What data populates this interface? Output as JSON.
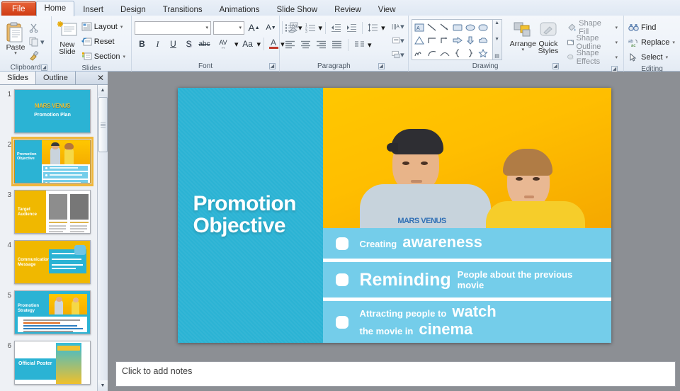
{
  "ribbon": {
    "tabs": [
      {
        "label": "File",
        "type": "file"
      },
      {
        "label": "Home",
        "type": "active"
      },
      {
        "label": "Insert",
        "type": "normal"
      },
      {
        "label": "Design",
        "type": "normal"
      },
      {
        "label": "Transitions",
        "type": "normal"
      },
      {
        "label": "Animations",
        "type": "normal"
      },
      {
        "label": "Slide Show",
        "type": "normal"
      },
      {
        "label": "Review",
        "type": "normal"
      },
      {
        "label": "View",
        "type": "normal"
      }
    ],
    "groups": {
      "clipboard": {
        "label": "Clipboard",
        "paste_label": "Paste",
        "cut_tooltip": "Cut",
        "copy_tooltip": "Copy",
        "format_painter_tooltip": "Format Painter"
      },
      "slides": {
        "label": "Slides",
        "new_slide_label": "New\nSlide",
        "new_slide_line1": "New",
        "new_slide_line2": "Slide",
        "layout_label": "Layout",
        "reset_label": "Reset",
        "section_label": "Section"
      },
      "font": {
        "label": "Font",
        "font_name_value": "",
        "font_name_placeholder": "",
        "font_size_value": "",
        "grow_font": "A",
        "shrink_font": "A",
        "clear_formatting": "clear-formatting",
        "bold": "B",
        "italic": "I",
        "underline": "U",
        "shadow": "S",
        "strikethrough": "abc",
        "char_spacing": "AV",
        "change_case": "Aa",
        "font_color": "A"
      },
      "paragraph": {
        "label": "Paragraph"
      },
      "drawing": {
        "label": "Drawing",
        "arrange_label": "Arrange",
        "quick_styles_line1": "Quick",
        "quick_styles_line2": "Styles",
        "shape_fill_label": "Shape Fill",
        "shape_outline_label": "Shape Outline",
        "shape_effects_label": "Shape Effects"
      },
      "editing": {
        "label": "Editing",
        "find_label": "Find",
        "replace_label": "Replace",
        "select_label": "Select"
      }
    }
  },
  "left_panel": {
    "tab_slides": "Slides",
    "tab_outline": "Outline",
    "close_label": "✕",
    "scroll_up": "▲",
    "scroll_down": "▼",
    "thumbnails": [
      {
        "number": "1",
        "title": "Promotion Plan",
        "brand": "MARS VENUS",
        "selected": false
      },
      {
        "number": "2",
        "title": "Promotion Objective",
        "selected": true
      },
      {
        "number": "3",
        "title": "Target Audience",
        "selected": false
      },
      {
        "number": "4",
        "title": "Communication Message",
        "selected": false
      },
      {
        "number": "5",
        "title": "Promotion Strategy",
        "selected": false
      },
      {
        "number": "6",
        "title": "Official Poster",
        "selected": false
      }
    ]
  },
  "slide": {
    "title_line1": "Promotion",
    "title_line2": "Objective",
    "shirt_text": "MARS VENUS",
    "bullets": [
      {
        "prefix": "Creating",
        "emphasis": "awareness",
        "suffix": ""
      },
      {
        "prefix": "",
        "emphasis": "Reminding",
        "suffix": "People about the previous movie"
      },
      {
        "prefix": "Attracting people to",
        "emphasis": "watch",
        "suffix": "the movie in",
        "emphasis2": "cinema"
      }
    ]
  },
  "notes": {
    "placeholder": "Click to add notes"
  },
  "colors": {
    "slide_cyan": "#2bb3d4",
    "bar_blue": "#74cdea",
    "photo_yellow": "#ffc700",
    "file_tab_red": "#cf3a12",
    "selection_gold": "#f0b73b"
  }
}
